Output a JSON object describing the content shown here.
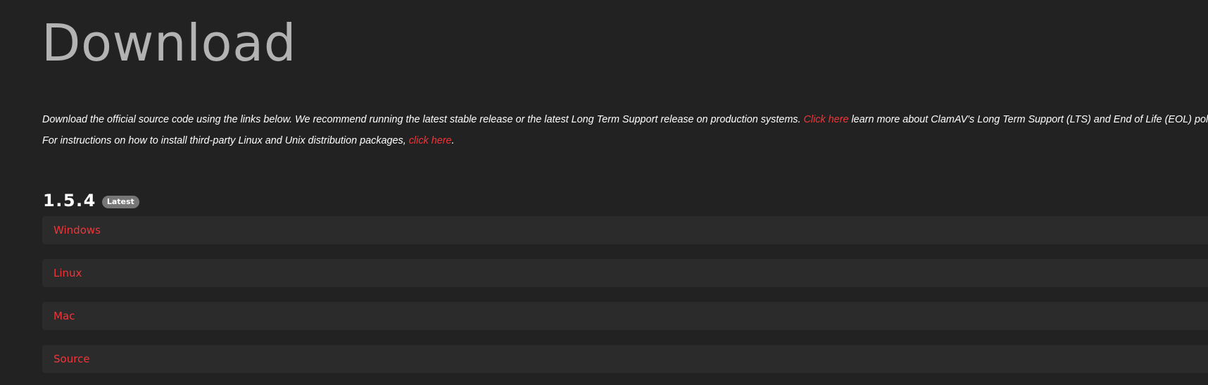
{
  "page": {
    "title": "Download"
  },
  "intro": {
    "line1_before": "Download the official source code using the links below. We recommend running the latest stable release or the latest Long Term Support release on production systems. ",
    "line1_link": "Click here",
    "line1_after": " learn more about ClamAV's Long Term Support (LTS) and End of Life (EOL) policies.",
    "line2_before": "For instructions on how to install third-party Linux and Unix distribution packages, ",
    "line2_link": "click here",
    "line2_after": "."
  },
  "release": {
    "version": "1.5.4",
    "badge": "Latest",
    "platforms": [
      {
        "label": "Windows"
      },
      {
        "label": "Linux"
      },
      {
        "label": "Mac"
      },
      {
        "label": "Source"
      }
    ]
  },
  "colors": {
    "background": "#222222",
    "title": "#b3b3b3",
    "link": "#f0353a",
    "panel": "#2b2b2b",
    "badge": "#767676"
  }
}
